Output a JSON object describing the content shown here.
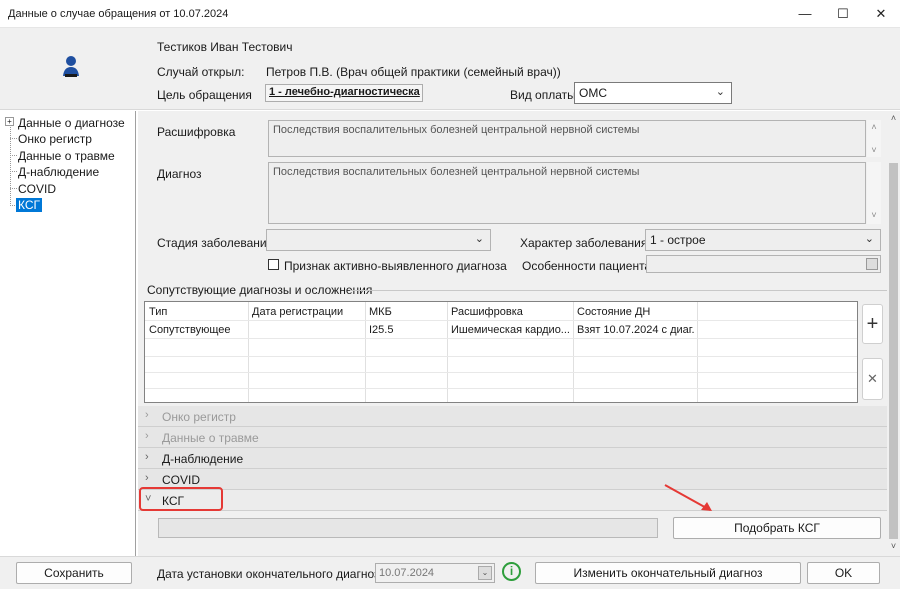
{
  "window": {
    "title": "Данные о случае обращения от 10.07.2024",
    "minimize": "—",
    "maximize": "☐",
    "close": "✕"
  },
  "header": {
    "patient_name": "Тестиков Иван Тестович",
    "opened_label": "Случай открыл:",
    "opened_value": "Петров П.В. (Врач общей практики (семейный врач))",
    "purpose_label": "Цель обращения",
    "purpose_value": "1 - лечебно-диагностическа",
    "payment_label": "Вид оплаты",
    "payment_value": "ОМС"
  },
  "tree": {
    "items": [
      {
        "label": "Данные о диагнозе"
      },
      {
        "label": "Онко регистр"
      },
      {
        "label": "Данные о травме"
      },
      {
        "label": "Д-наблюдение"
      },
      {
        "label": "COVID"
      },
      {
        "label": "КСГ"
      }
    ],
    "expand_glyph": "+"
  },
  "diagnosis": {
    "decoding_label": "Расшифровка",
    "decoding_value": "Последствия воспалительных болезней центральной нервной системы",
    "diagnosis_label": "Диагноз",
    "diagnosis_value": "Последствия воспалительных болезней центральной нервной системы",
    "stage_label": "Стадия заболевания",
    "stage_value": "",
    "character_label": "Характер заболевания",
    "character_value": "1 - острое",
    "active_label": "Признак активно-выявленного диагноза",
    "patient_features_label": "Особенности пациента",
    "patient_features_value": ""
  },
  "comorbid": {
    "title": "Сопутствующие диагнозы и осложнения",
    "columns": [
      "Тип",
      "Дата регистрации",
      "МКБ",
      "Расшифровка",
      "Состояние ДН"
    ],
    "rows": [
      [
        "Сопутствующее",
        "",
        "I25.5",
        "Ишемическая кардио...",
        "Взят 10.07.2024 с диаг..."
      ]
    ],
    "add_glyph": "+",
    "remove_glyph": "✕"
  },
  "accordion": [
    {
      "label": "Онко регистр",
      "arrow": "›",
      "disabled": true
    },
    {
      "label": "Данные о травме",
      "arrow": "›",
      "disabled": true
    },
    {
      "label": "Д-наблюдение",
      "arrow": "›",
      "disabled": false
    },
    {
      "label": "COVID",
      "arrow": "›",
      "disabled": false
    },
    {
      "label": "КСГ",
      "arrow": "˅",
      "disabled": false
    }
  ],
  "ksg": {
    "value": "",
    "select_button": "Подобрать КСГ"
  },
  "footer": {
    "save": "Сохранить",
    "final_date_label": "Дата установки окончательного диагноза:",
    "final_date_value": "10.07.2024",
    "info_glyph": "i",
    "change_button": "Изменить окончательный диагноз",
    "ok": "OK"
  },
  "colors": {
    "selection": "#0078d7",
    "highlight_box": "#e53935",
    "info_icon": "#2e9e3c"
  }
}
